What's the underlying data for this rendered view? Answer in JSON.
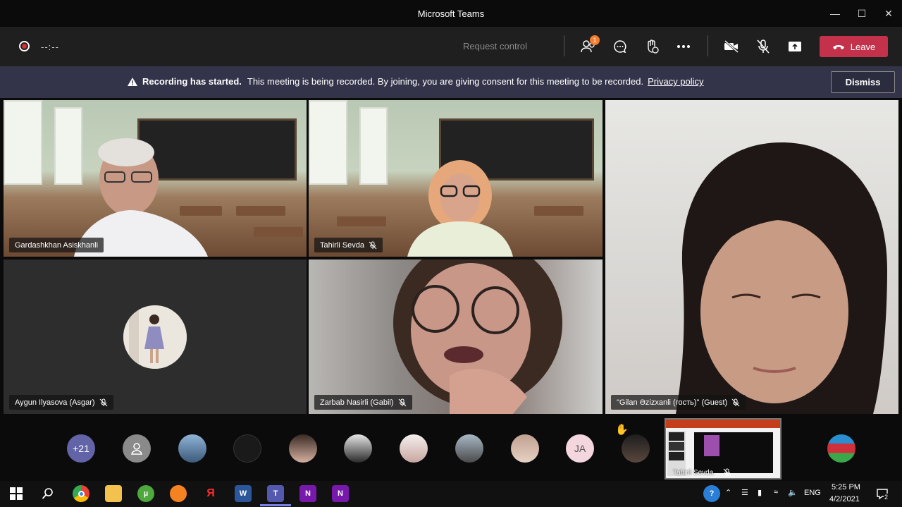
{
  "window": {
    "title": "Microsoft Teams"
  },
  "toolbar": {
    "recording_time": "--:--",
    "request_control": "Request control",
    "participants_badge": "1",
    "leave_label": "Leave"
  },
  "banner": {
    "bold": "Recording has started.",
    "text": "This meeting is being recorded. By joining, you are giving consent for this meeting to be recorded.",
    "link": "Privacy policy",
    "dismiss": "Dismiss"
  },
  "tiles": {
    "t1": "Gardashkhan Asiskhanli",
    "t2": "Tahirli Sevda",
    "t3": "Aygun Ilyasova (Asgar)",
    "t4": "Zarbab Nasirli (Gabil)",
    "t5": "\"Gilan Əzizxanli (гость)\" (Guest)"
  },
  "roster": {
    "more_count": "+21",
    "initials": "JA",
    "shared_name": "Tahirli Sevda"
  },
  "taskbar": {
    "language": "ENG",
    "time": "5:25 PM",
    "date": "4/2/2021",
    "notifications": "2"
  },
  "colors": {
    "leave": "#c4314b",
    "banner": "#33344a",
    "toolbar": "#1f1f1f",
    "roster_accent": "#6264a7"
  }
}
